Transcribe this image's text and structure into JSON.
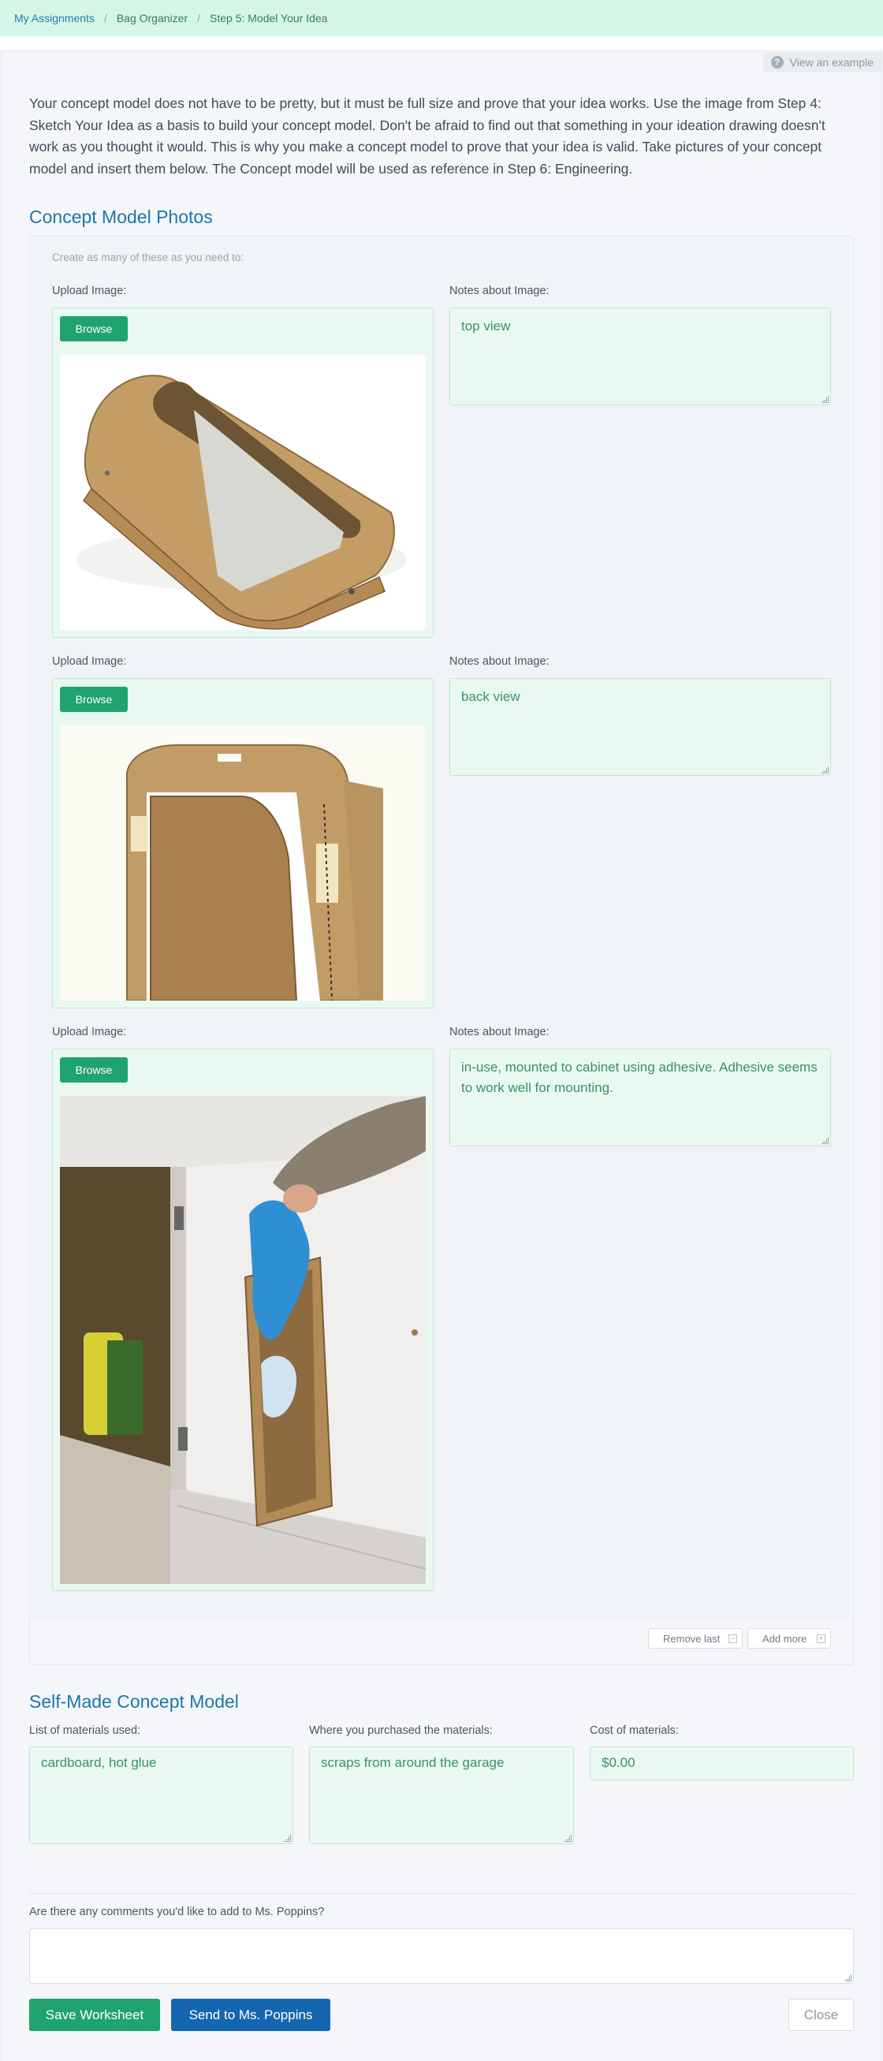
{
  "breadcrumb": {
    "items": [
      "My Assignments",
      "Bag Organizer",
      "Step 5: Model Your Idea"
    ]
  },
  "view_example_label": "View an example",
  "intro_text": "Your concept model does not have to be pretty, but it must be full size and prove that your idea works. Use the image from Step 4: Sketch Your Idea as a basis to build your concept model. Don't be afraid to find out that something in your ideation drawing doesn't work as you thought it would. This is why you make a concept model to prove that your idea is valid. Take pictures of your concept model and insert them below. The Concept model will be used as reference in Step 6: Engineering.",
  "photos_section": {
    "title": "Concept Model Photos",
    "hint": "Create as many of these as you need to:",
    "upload_label": "Upload Image:",
    "notes_label": "Notes about Image:",
    "browse_label": "Browse",
    "entries": [
      {
        "note": "top view"
      },
      {
        "note": "back view"
      },
      {
        "note": "in-use, mounted to cabinet using adhesive. Adhesive seems to work well for mounting."
      }
    ],
    "remove_last_label": "Remove last",
    "add_more_label": "Add more"
  },
  "self_made_section": {
    "title": "Self-Made Concept Model",
    "materials_label": "List of materials used:",
    "materials_value": "cardboard, hot glue",
    "purchase_label": "Where you purchased the materials:",
    "purchase_value": "scraps from around the garage",
    "cost_label": "Cost of materials:",
    "cost_value": "$0.00"
  },
  "comments_label": "Are there any comments you'd like to add to Ms. Poppins?",
  "actions": {
    "save_label": "Save Worksheet",
    "send_label": "Send to Ms. Poppins",
    "close_label": "Close"
  },
  "colors": {
    "accent_green": "#1fa36f",
    "accent_blue": "#1466b0",
    "field_bg": "#e9f9f1",
    "heading": "#1d76a8"
  }
}
